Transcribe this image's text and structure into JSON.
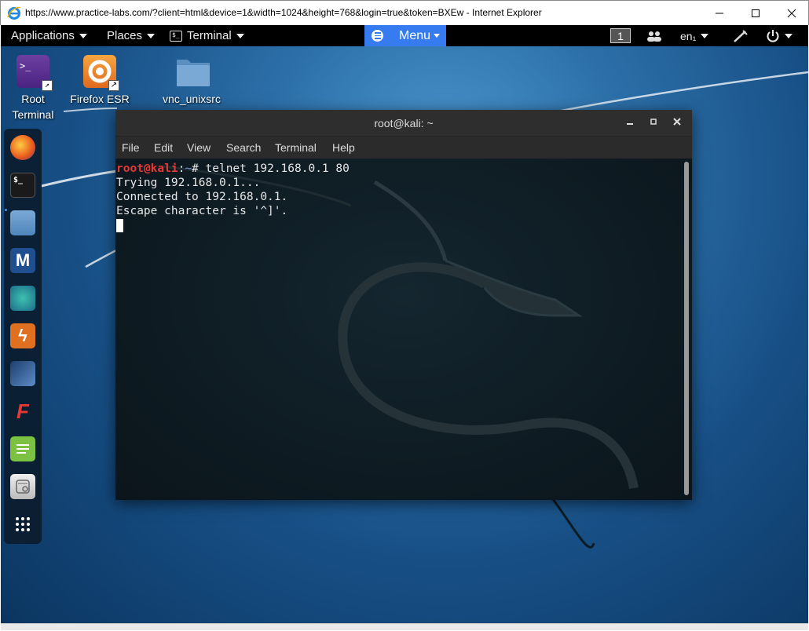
{
  "browser": {
    "title": "https://www.practice-labs.com/?client=html&device=1&width=1024&height=768&login=true&token=BXEw - Internet Explorer"
  },
  "topbar": {
    "applications": "Applications",
    "places": "Places",
    "terminal": "Terminal",
    "terminal_icon_glyph": "$_",
    "menu": "Menu",
    "workspace": "1",
    "language": "en₁"
  },
  "desktop_icons": {
    "root_terminal_line1": "Root",
    "root_terminal_line2": "Terminal",
    "root_terminal_glyph": ">_",
    "firefox": "Firefox ESR",
    "vnc": "vnc_unixsrc"
  },
  "dock": {
    "terminal_glyph": "$_",
    "metasploit_glyph": "M",
    "burp_glyph": "ϟ",
    "faraday_glyph": "F"
  },
  "terminal": {
    "title": "root@kali: ~",
    "menu": [
      "File",
      "Edit",
      "View",
      "Search",
      "Terminal",
      "Help"
    ],
    "prompt_user": "root@kali",
    "prompt_sep": ":",
    "prompt_path": "~",
    "prompt_hash": "# ",
    "command": "telnet 192.168.0.1 80",
    "output": [
      "Trying 192.168.0.1...",
      "Connected to 192.168.0.1.",
      "Escape character is '^]'."
    ]
  },
  "colors": {
    "menu_accent": "#367bf0",
    "prompt_user": "#e53935",
    "prompt_path": "#6b8fd6"
  }
}
